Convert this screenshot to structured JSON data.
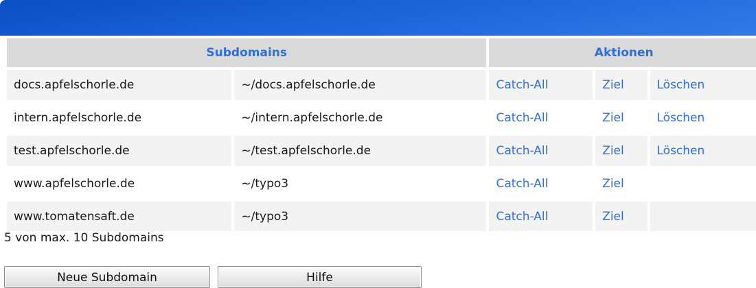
{
  "table": {
    "headers": {
      "subdomains": "Subdomains",
      "aktionen": "Aktionen"
    },
    "rows": [
      {
        "domain": "docs.apfelschorle.de",
        "path": "~/docs.apfelschorle.de",
        "catch_all": "Catch-All",
        "ziel": "Ziel",
        "loeschen": "Löschen"
      },
      {
        "domain": "intern.apfelschorle.de",
        "path": "~/intern.apfelschorle.de",
        "catch_all": "Catch-All",
        "ziel": "Ziel",
        "loeschen": "Löschen"
      },
      {
        "domain": "test.apfelschorle.de",
        "path": "~/test.apfelschorle.de",
        "catch_all": "Catch-All",
        "ziel": "Ziel",
        "loeschen": "Löschen"
      },
      {
        "domain": "www.apfelschorle.de",
        "path": "~/typo3",
        "catch_all": "Catch-All",
        "ziel": "Ziel",
        "loeschen": ""
      },
      {
        "domain": "www.tomatensaft.de",
        "path": "~/typo3",
        "catch_all": "Catch-All",
        "ziel": "Ziel",
        "loeschen": ""
      }
    ]
  },
  "footer": {
    "count_text": "5 von max. 10 Subdomains"
  },
  "buttons": {
    "new_subdomain": "Neue Subdomain",
    "help": "Hilfe"
  },
  "colors": {
    "accent": "#2e6fdb",
    "header_bar": "#1f66dc",
    "header_cell": "#dadada"
  }
}
